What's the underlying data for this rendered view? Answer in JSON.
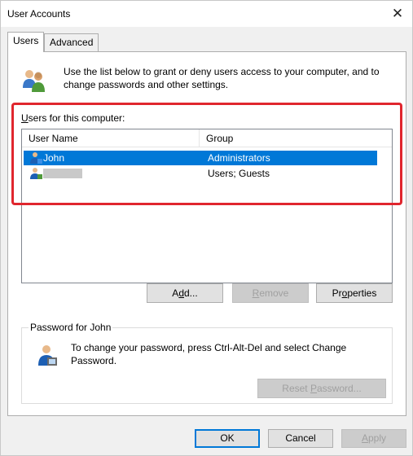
{
  "window": {
    "title": "User Accounts",
    "close_glyph": "✕"
  },
  "tabs": [
    {
      "label": "Users",
      "active": true
    },
    {
      "label": "Advanced",
      "active": false
    }
  ],
  "intro": {
    "icon": "users-icon",
    "text": "Use the list below to grant or deny users access to your computer, and to change passwords and other settings."
  },
  "users_section": {
    "label": "Users for this computer:",
    "columns": [
      "User Name",
      "Group"
    ],
    "rows": [
      {
        "name": "John",
        "group": "Administrators",
        "selected": true,
        "icon": "user-icon"
      },
      {
        "name": "",
        "group": "Users; Guests",
        "selected": false,
        "icon": "user-icon",
        "redacted": true
      }
    ]
  },
  "buttons": {
    "add": "Add...",
    "remove": "Remove",
    "properties": "Properties",
    "reset_password": "Reset Password...",
    "ok": "OK",
    "cancel": "Cancel",
    "apply": "Apply"
  },
  "password_section": {
    "label": "Password for John",
    "icon": "password-user-icon",
    "text": "To change your password, press Ctrl-Alt-Del and select Change Password."
  },
  "colors": {
    "selection": "#0078d7",
    "highlight_box": "#e0262e"
  }
}
